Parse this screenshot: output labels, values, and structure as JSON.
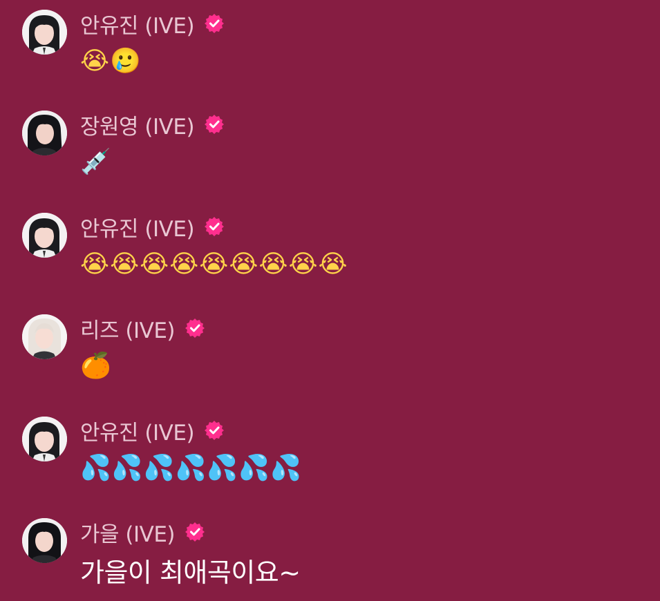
{
  "messages": [
    {
      "id": "m1",
      "avatar": "yujin",
      "name": "안유진 (IVE)",
      "verified": true,
      "body": "😭🥲",
      "body_type": "emoji"
    },
    {
      "id": "m2",
      "avatar": "wonyoung",
      "name": "장원영 (IVE)",
      "verified": true,
      "body": "💉",
      "body_type": "emoji"
    },
    {
      "id": "m3",
      "avatar": "yujin",
      "name": "안유진 (IVE)",
      "verified": true,
      "body": "😭😭😭😭😭😭😭😭😭",
      "body_type": "emoji"
    },
    {
      "id": "m4",
      "avatar": "liz",
      "name": "리즈 (IVE)",
      "verified": true,
      "body": "🍊",
      "body_type": "emoji"
    },
    {
      "id": "m5",
      "avatar": "yujin",
      "name": "안유진 (IVE)",
      "verified": true,
      "body": "💦💦💦💦💦💦💦",
      "body_type": "emoji"
    },
    {
      "id": "m6",
      "avatar": "gaeul",
      "name": "가을 (IVE)",
      "verified": true,
      "body": "가을이 최애곡이요~",
      "body_type": "text"
    }
  ],
  "colors": {
    "background": "#861d42",
    "name_text": "#e9c7d3",
    "body_text": "#ffffff",
    "verified_badge": "#ff2f8e"
  },
  "icons": {
    "verified": "verified-badge-icon"
  }
}
